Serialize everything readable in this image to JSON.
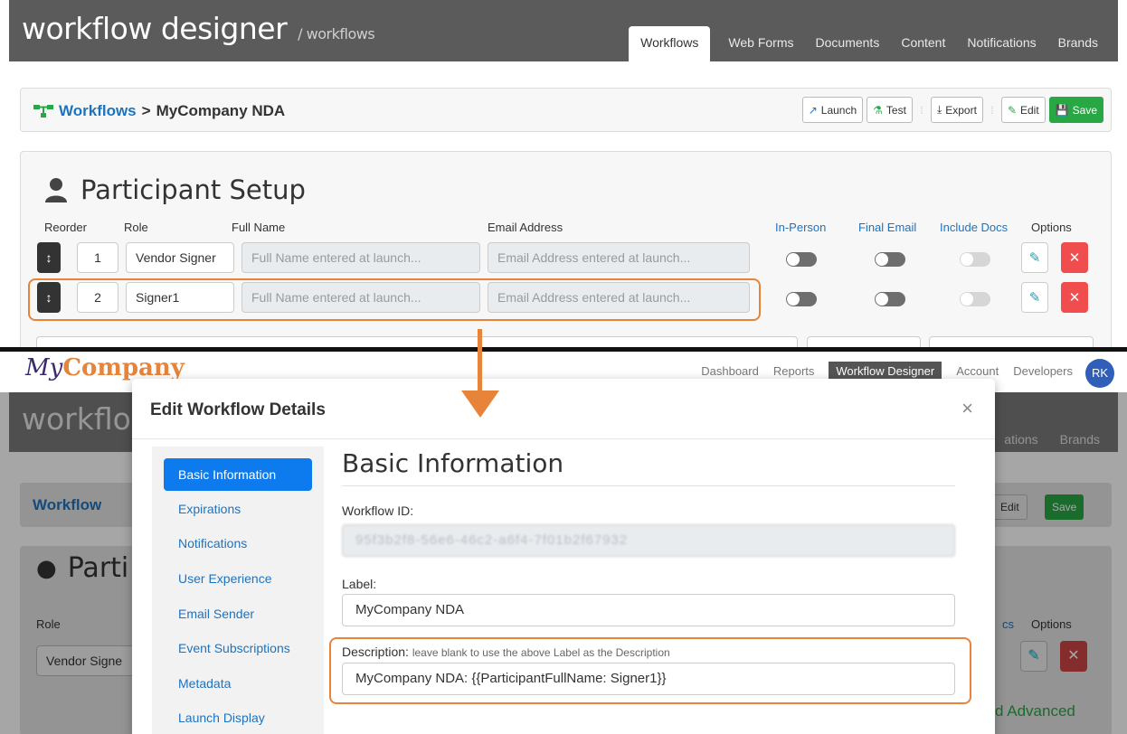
{
  "top": {
    "app": {
      "title": "workflow designer",
      "subtitle": "/ workflows"
    },
    "tabs": [
      "Workflows",
      "Web Forms",
      "Documents",
      "Content",
      "Notifications",
      "Brands"
    ],
    "breadcrumb": {
      "link": "Workflows",
      "sep": ">",
      "current": "MyCompany NDA"
    },
    "toolbar": {
      "launch": "Launch",
      "test": "Test",
      "export": "Export",
      "edit": "Edit",
      "save": "Save"
    },
    "participant": {
      "title": "Participant Setup",
      "columns": {
        "reorder": "Reorder",
        "role": "Role",
        "full_name": "Full Name",
        "email": "Email Address",
        "in_person": "In-Person",
        "final_email": "Final Email",
        "include_docs": "Include Docs",
        "options": "Options"
      },
      "rows": [
        {
          "order": "1",
          "role": "Vendor Signer",
          "name_placeholder": "Full Name entered at launch...",
          "email_placeholder": "Email Address entered at launch..."
        },
        {
          "order": "2",
          "role": "Signer1",
          "name_placeholder": "Full Name entered at launch...",
          "email_placeholder": "Email Address entered at launch..."
        }
      ]
    }
  },
  "bottom": {
    "logo": {
      "my": "My",
      "company": "Company"
    },
    "nav": [
      "Dashboard",
      "Reports",
      "Workflow Designer",
      "Account",
      "Developers"
    ],
    "avatar": "RK",
    "bg": {
      "title": "workflow",
      "tabs": [
        "ations",
        "Brands"
      ],
      "crumb": "Workflow",
      "edit": "Edit",
      "save": "Save",
      "parti": "Parti",
      "role": "Role",
      "role_value": "Vendor Signe",
      "options": "Options",
      "cs": "cs",
      "advanced": "d Advanced"
    },
    "modal": {
      "title": "Edit Workflow Details",
      "close": "×",
      "menu": [
        "Basic Information",
        "Expirations",
        "Notifications",
        "User Experience",
        "Email Sender",
        "Event Subscriptions",
        "Metadata",
        "Launch Display"
      ],
      "section": "Basic Information",
      "workflow_id_label": "Workflow ID:",
      "workflow_id_value": "95f3b2f8-56e6-46c2-a6f4-7f01b2f67932",
      "label_label": "Label:",
      "label_value": "MyCompany NDA",
      "description_label": "Description:",
      "description_hint": "leave blank to use the above Label as the Description",
      "description_value": "MyCompany NDA: {{ParticipantFullName: Signer1}}"
    }
  },
  "colors": {
    "highlight": "#e8833a",
    "link": "#1e73be",
    "save": "#28a745",
    "delete": "#f04e4e",
    "active_menu": "#0d7aee"
  }
}
